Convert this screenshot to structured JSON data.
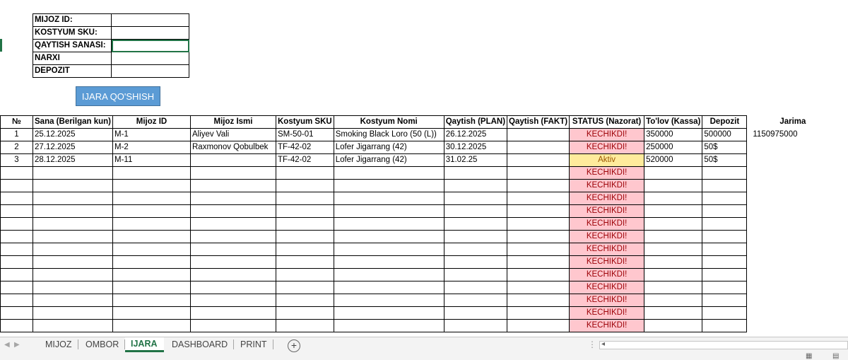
{
  "form": {
    "rows": [
      {
        "label": "MIJOZ ID:",
        "value": ""
      },
      {
        "label": "KOSTYUM SKU:",
        "value": ""
      },
      {
        "label": "QAYTISH SANASI:",
        "value": ""
      },
      {
        "label": "NARXI",
        "value": ""
      },
      {
        "label": "DEPOZIT",
        "value": ""
      }
    ],
    "button_label": "IJARA QO'SHISH"
  },
  "table": {
    "headers": [
      "№",
      "Sana (Berilgan kun)",
      "Mijoz ID",
      "Mijoz Ismi",
      "Kostyum SKU",
      "Kostyum Nomi",
      "Qaytish (PLAN)",
      "Qaytish (FAKT)",
      "STATUS (Nazorat)",
      "To'lov (Kassa)",
      "Depozit",
      "Jarima"
    ],
    "rows": [
      {
        "no": "1",
        "sana": "25.12.2025",
        "mijoz_id": "M-1",
        "ismi": "Aliyev Vali",
        "sku": "SM-50-01",
        "nomi": "Smoking Black Loro (50 (L))",
        "plan": "26.12.2025",
        "fakt": "",
        "status": "KECHIKDI!",
        "tolov": "350000",
        "depozit": "500000",
        "jarima": "1150975000"
      },
      {
        "no": "2",
        "sana": "27.12.2025",
        "mijoz_id": "M-2",
        "ismi": "Raxmonov Qobulbek",
        "sku": "TF-42-02",
        "nomi": "Lofer Jigarrang (42)",
        "plan": "30.12.2025",
        "fakt": "",
        "status": "KECHIKDI!",
        "tolov": "250000",
        "depozit": "50$",
        "jarima": ""
      },
      {
        "no": "3",
        "sana": "28.12.2025",
        "mijoz_id": "M-11",
        "ismi": "",
        "sku": "TF-42-02",
        "nomi": "Lofer Jigarrang (42)",
        "plan": "31.02.25",
        "fakt": "",
        "status": "Aktiv",
        "tolov": "520000",
        "depozit": "50$",
        "jarima": ""
      }
    ],
    "empty_status": [
      "KECHIKDI!",
      "KECHIKDI!",
      "KECHIKDI!",
      "KECHIKDI!",
      "KECHIKDI!",
      "KECHIKDI!",
      "KECHIKDI!",
      "KECHIKDI!",
      "KECHIKDI!",
      "KECHIKDI!",
      "KECHIKDI!",
      "KECHIKDI!",
      "KECHIKDI!"
    ]
  },
  "sheets": {
    "tabs": [
      "MIJOZ",
      "OMBOR",
      "IJARA",
      "DASHBOARD",
      "PRINT"
    ],
    "active": "IJARA",
    "add_icon": "plus-circle-icon"
  },
  "colors": {
    "status_bad_bg": "#ffc7ce",
    "status_bad_text": "#9c0006",
    "status_ok_bg": "#ffeb9c",
    "status_ok_text": "#9c5700",
    "button_bg": "#5b9bd5",
    "accent": "#217346"
  }
}
